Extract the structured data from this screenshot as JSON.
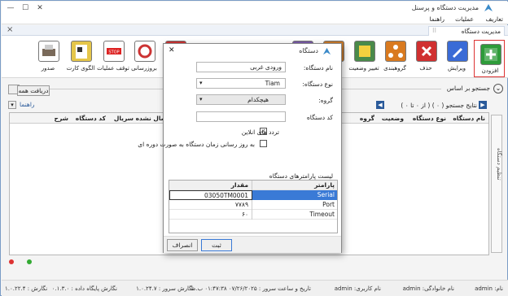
{
  "window": {
    "title": "مدیریت دستگاه و پرسنل",
    "minimize": "—",
    "maximize": "☐",
    "close": "✕"
  },
  "menu": [
    "تعاریف",
    "عملیات",
    "راهنما"
  ],
  "tab": {
    "label": "مدیریت دستگاه",
    "close": "×"
  },
  "toolbar": [
    {
      "label": "افزودن",
      "color": "#2e9b3a",
      "selected": true
    },
    {
      "label": "ویرایش",
      "color": "#3a6bd6"
    },
    {
      "label": "حذف",
      "color": "#d03030"
    },
    {
      "label": "گروهبندی",
      "color": "#d97a1f"
    },
    {
      "label": "تغییر وضعیت",
      "color": "#4a8a4a"
    },
    {
      "label": "",
      "color": "#c97a2a"
    },
    {
      "label": "",
      "color": "#7a5aa8"
    },
    {
      "label": "",
      "color": "#c33"
    },
    {
      "label": "بروزرسانی",
      "color": "#8a8a3a"
    },
    {
      "label": "توقف عملیات",
      "color": "#d22"
    },
    {
      "label": "الگوی کارت",
      "color": "#e5c64a"
    },
    {
      "label": "صدور",
      "color": "#7a6a5a"
    }
  ],
  "search": {
    "label": "جستجو بر اساس",
    "button": "دریافت همه",
    "results_label": "نتایج جستجو ( ۰ ) ( از ۰ تا ۰ )",
    "help": "راهنما"
  },
  "grid": {
    "columns": [
      "نام دستگاه",
      "نوع دستگاه",
      "وضعیت",
      "گروه",
      "ارسال نشده",
      "سریال",
      "کد دستگاه",
      "شرح"
    ]
  },
  "side_tab": "تنظیم دستگاه",
  "dialog": {
    "title": "دستگاه",
    "name_label": "نام دستگاه:",
    "name_value": "ورودی غربی",
    "type_label": "نوع دستگاه:",
    "type_value": "Tiam",
    "group_label": "گروه:",
    "group_value": "هیچکدام",
    "code_label": "کد دستگاه",
    "code_value": "",
    "online_label": "تردد های انلاین",
    "online_checked": true,
    "periodic_label": "به روز رسانی زمان دستگاه به صورت دوره ای",
    "periodic_checked": false,
    "params_title": "لیست پارامترهای دستگاه",
    "params_header_value": "مقدار",
    "params_header_name": "پارامتر",
    "params": [
      {
        "name": "Serial",
        "value": "03050TM0001",
        "selected": true
      },
      {
        "name": "Port",
        "value": "۷۷۸۹"
      },
      {
        "name": "Timeout",
        "value": "۶۰"
      }
    ],
    "ok_button": "ثبت",
    "cancel_button": "انصراف"
  },
  "status": {
    "name": "نام: admin",
    "family": "نام خانوادگی: admin",
    "username": "نام کاربری: admin",
    "datetime": "تاریخ و ساعت سرور : ۰۷/۲۶/۲۰۲۵ ۰۱:۴۷:۳۸ ب.ظ",
    "server_version": "نگارش سرور : ۱.۰.۲۴.۷",
    "db_version": "نگارش پایگاه داده : ۰.۱.۳.۰",
    "app_version": "نگارش : ۱.۰.۲۲.۴"
  }
}
